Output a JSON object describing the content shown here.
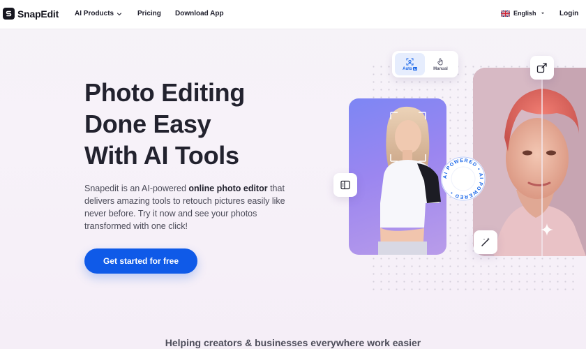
{
  "header": {
    "logo_text": "SnapEdit",
    "nav": [
      {
        "label": "AI Products",
        "has_dropdown": true
      },
      {
        "label": "Pricing"
      },
      {
        "label": "Download App"
      }
    ],
    "language": "English",
    "login": "Login"
  },
  "hero": {
    "title_lines": [
      "Photo Editing",
      "Done Easy",
      "With AI Tools"
    ],
    "desc_part1": "Snapedit is an AI-powered ",
    "desc_bold": "online photo editor",
    "desc_part2": " that delivers amazing tools to retouch pictures easily like never before. Try it now and see your photos transformed with one click!",
    "cta": "Get started for free"
  },
  "visual": {
    "toggle": {
      "auto_label": "Auto",
      "auto_tag": "AI",
      "manual_label": "Manual"
    },
    "badge_text": "AI POWERED • AI POWERED •",
    "icons": [
      "scan-face-icon",
      "hand-pointer-icon",
      "compare-icon",
      "expand-icon",
      "magic-wand-icon",
      "sparkle-icon"
    ]
  },
  "footer_tagline": "Helping creators & businesses everywhere work easier",
  "colors": {
    "primary": "#0f5ae8",
    "text": "#22222e",
    "accent_purple": "#9b86f0"
  }
}
